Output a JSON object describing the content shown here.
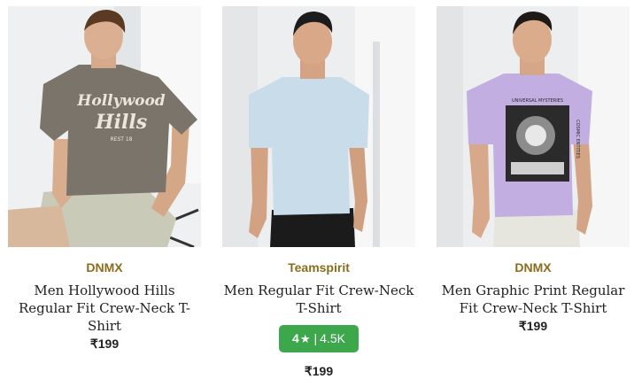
{
  "colors": {
    "brand": "#8a6d1c",
    "rating_bg": "#3ca84b",
    "text": "#222222"
  },
  "products": [
    {
      "image_icon": "tshirt-model-photo",
      "brand": "DNMX",
      "title": "Men Hollywood Hills Regular Fit Crew-Neck T-Shirt",
      "price": "₹199",
      "tee_print": [
        "Hollywood",
        "Hills",
        "REST 18"
      ]
    },
    {
      "image_icon": "tshirt-model-photo",
      "brand": "Teamspirit",
      "title": "Men Regular Fit Crew-Neck T-Shirt",
      "rating": {
        "value": "4",
        "star_icon": "star-icon",
        "count": "4.5K"
      },
      "price": "₹199"
    },
    {
      "image_icon": "tshirt-model-photo",
      "brand": "DNMX",
      "title": "Men Graphic Print Regular Fit Crew-Neck T-Shirt",
      "price": "₹199",
      "tee_print": [
        "UNIVERSAL MYSTERIES",
        "COSMIC ENTITIES"
      ]
    }
  ]
}
